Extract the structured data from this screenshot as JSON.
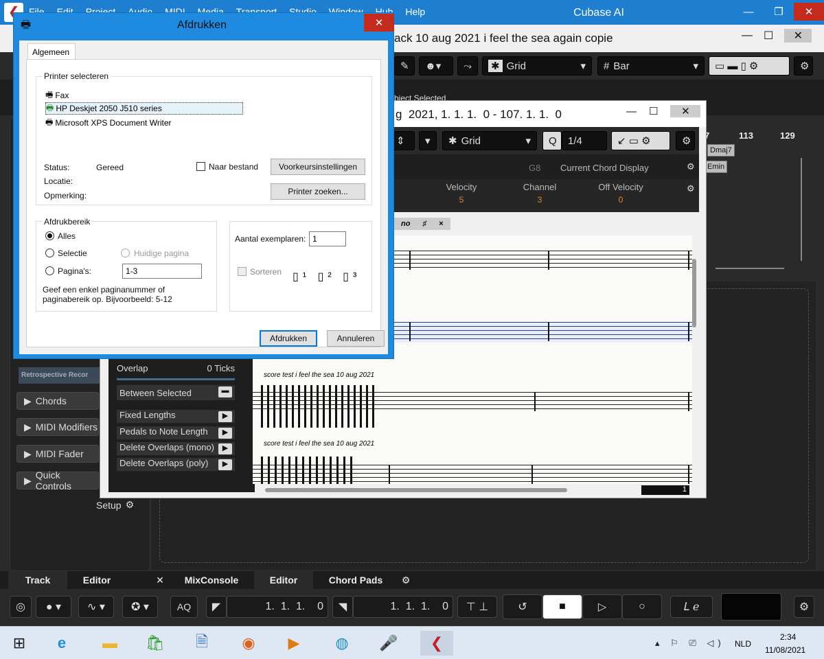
{
  "cubase": {
    "menu": [
      "File",
      "Edit",
      "Project",
      "Audio",
      "MIDI",
      "Media",
      "Transport",
      "Studio",
      "Window",
      "Hub",
      "Help"
    ],
    "app_title": "Cubase AI",
    "project_title": "ack  10 aug  2021  i feel the sea again copie",
    "toolbar": {
      "grid_label": "Grid",
      "bar_label": "Bar"
    },
    "info_text": "bject Selected",
    "inspector": {
      "retrospective": "Retrospective Recor",
      "sections": [
        "Chords",
        "MIDI Modifiers",
        "MIDI Fader",
        "Quick Controls"
      ],
      "setup": "Setup"
    },
    "right_panel": {
      "ruler": [
        "7",
        "113",
        "129"
      ],
      "chords": [
        "Dmaj7",
        "Emin"
      ]
    },
    "lower_tabs": {
      "track": "Track",
      "editor": "Editor",
      "mixconsole": "MixConsole",
      "editor2": "Editor",
      "chordpads": "Chord Pads"
    },
    "transport": {
      "aq": "AQ",
      "left_locator": "1.  1.  1.    0",
      "right_locator": "1.  1.  1.    0"
    }
  },
  "score_editor": {
    "title": "g  2021, 1. 1. 1.  0 - 107. 1. 1.  0",
    "grid_label": "Grid",
    "quantize": "1/4",
    "chord_display": "Current Chord Display",
    "g8": "G8",
    "params": [
      {
        "name": "Velocity",
        "value": "5"
      },
      {
        "name": "Channel",
        "value": "3"
      },
      {
        "name": "Off Velocity",
        "value": "0"
      }
    ],
    "tabs": [
      "no",
      "♯",
      "×"
    ],
    "left_panel": {
      "overlap_label": "Overlap",
      "overlap_value": "0 Ticks",
      "between": "Between Selected",
      "items": [
        "Fixed Lengths",
        "Pedals to Note Length",
        "Delete Overlaps (mono)",
        "Delete Overlaps (poly)"
      ]
    },
    "staff_captions": [
      "score test  i feel the sea  10 aug  2021",
      "score test  i feel the sea  10 aug  2021"
    ],
    "page_num": "1"
  },
  "print_dialog": {
    "title": "Afdrukken",
    "tab": "Algemeen",
    "printer_group": "Printer selecteren",
    "printers": [
      "Fax",
      "HP Deskjet 2050 J510 series",
      "Microsoft XPS Document Writer"
    ],
    "selected_printer": 1,
    "status_label": "Status:",
    "status_value": "Gereed",
    "location_label": "Locatie:",
    "comment_label": "Opmerking:",
    "to_file": "Naar bestand",
    "preferences": "Voorkeursinstellingen",
    "find_printer": "Printer zoeken...",
    "range_group": "Afdrukbereik",
    "all": "Alles",
    "selection": "Selectie",
    "current_page": "Huidige pagina",
    "pages": "Pagina's:",
    "pages_value": "1-3",
    "range_hint": "Geef een enkel paginanummer of paginabereik op. Bijvoorbeeld: 5-12",
    "copies_label": "Aantal exemplaren:",
    "copies_value": "1",
    "collate": "Sorteren",
    "print_btn": "Afdrukken",
    "cancel_btn": "Annuleren"
  },
  "taskbar": {
    "lang": "NLD",
    "time": "2:34",
    "date": "11/08/2021"
  }
}
